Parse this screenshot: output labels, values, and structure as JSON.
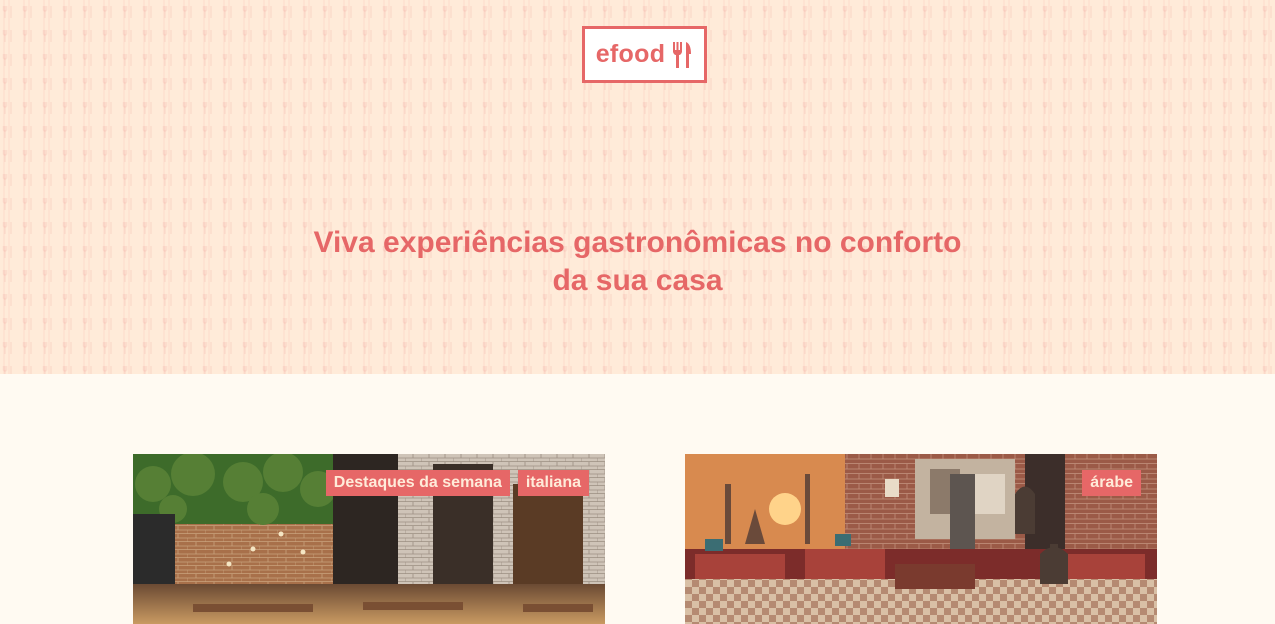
{
  "header": {
    "logo_text": "efood",
    "headline_line1": "Viva experiências gastronômicas no conforto",
    "headline_line2": "da sua casa"
  },
  "restaurants": [
    {
      "tags": [
        "Destaques da semana",
        "italiana"
      ]
    },
    {
      "tags": [
        "árabe"
      ]
    }
  ],
  "colors": {
    "primary": "#e66767",
    "hero_bg": "#ffebd9",
    "page_bg": "#fffaf2"
  }
}
